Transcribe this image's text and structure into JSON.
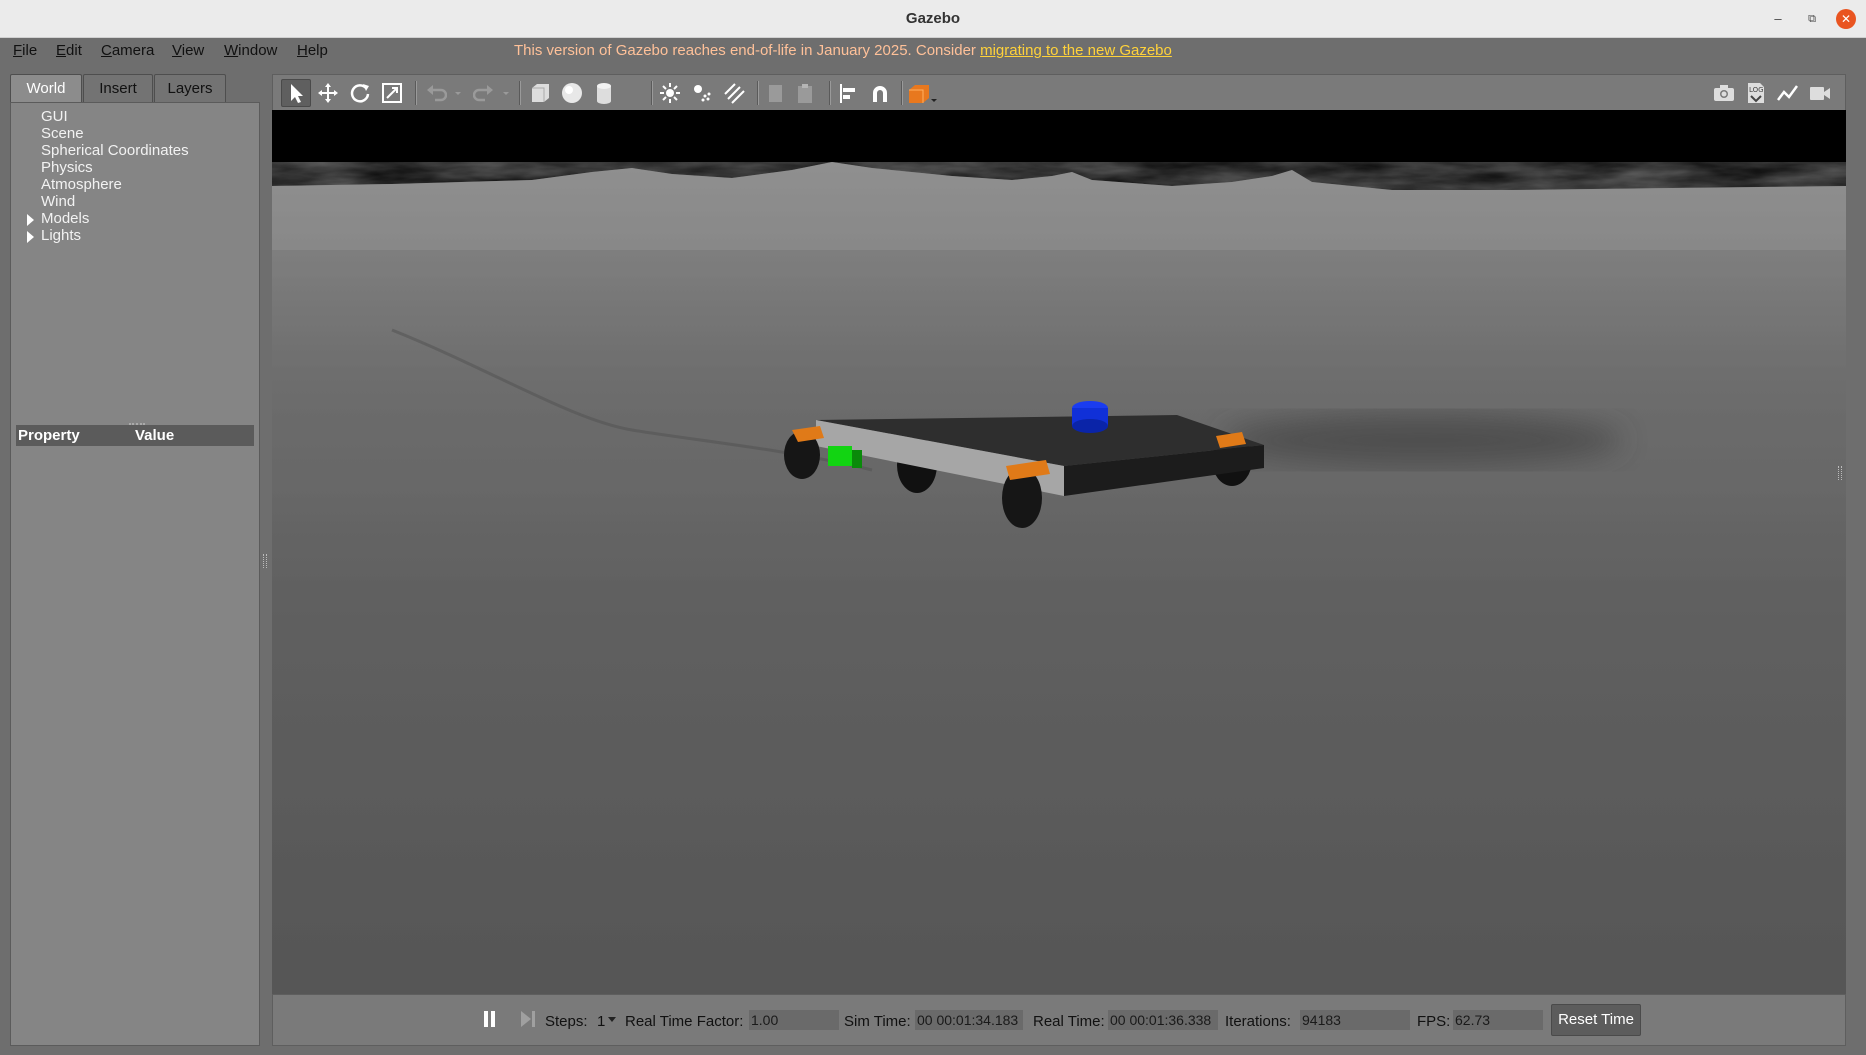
{
  "window": {
    "title": "Gazebo"
  },
  "menu": [
    "File",
    "Edit",
    "Camera",
    "View",
    "Window",
    "Help"
  ],
  "notice": {
    "message": "This version of Gazebo reaches end-of-life in January 2025. Consider ",
    "link": "migrating to the new Gazebo"
  },
  "left_panel": {
    "tabs": [
      "World",
      "Insert",
      "Layers"
    ],
    "active_tab": "World",
    "tree": [
      "GUI",
      "Scene",
      "Spherical Coordinates",
      "Physics",
      "Atmosphere",
      "Wind",
      "Models",
      "Lights"
    ],
    "property_header": {
      "property": "Property",
      "value": "Value"
    }
  },
  "toolbar": {
    "icons": [
      "select-arrow-icon",
      "translate-icon",
      "rotate-icon",
      "scale-icon",
      "undo-icon",
      "redo-icon",
      "box-icon",
      "sphere-icon",
      "cylinder-icon",
      "point-light-icon",
      "spot-light-icon",
      "directional-light-icon",
      "copy-icon",
      "paste-icon",
      "align-icon",
      "snap-magnet-icon",
      "view-angle-icon",
      "screenshot-icon",
      "log-icon",
      "plot-icon",
      "record-video-icon"
    ],
    "active_tool": "select-arrow-icon"
  },
  "status": {
    "steps_label": "Steps:",
    "steps_value": "1",
    "rtf_label": "Real Time Factor:",
    "rtf_value": "1.00",
    "sim_time_label": "Sim Time:",
    "sim_time_value": "00 00:01:34.183",
    "real_time_label": "Real Time:",
    "real_time_value": "00 00:01:36.338",
    "iterations_label": "Iterations:",
    "iterations_value": "94183",
    "fps_label": "FPS:",
    "fps_value": "62.73",
    "reset_label": "Reset Time"
  },
  "colors": {
    "accent_orange": "#e95420",
    "notice_link": "#ffd23a",
    "panel_bg": "#858585",
    "robot_blue": "#1030d8",
    "robot_green": "#10c810",
    "robot_orange": "#e07a18"
  }
}
